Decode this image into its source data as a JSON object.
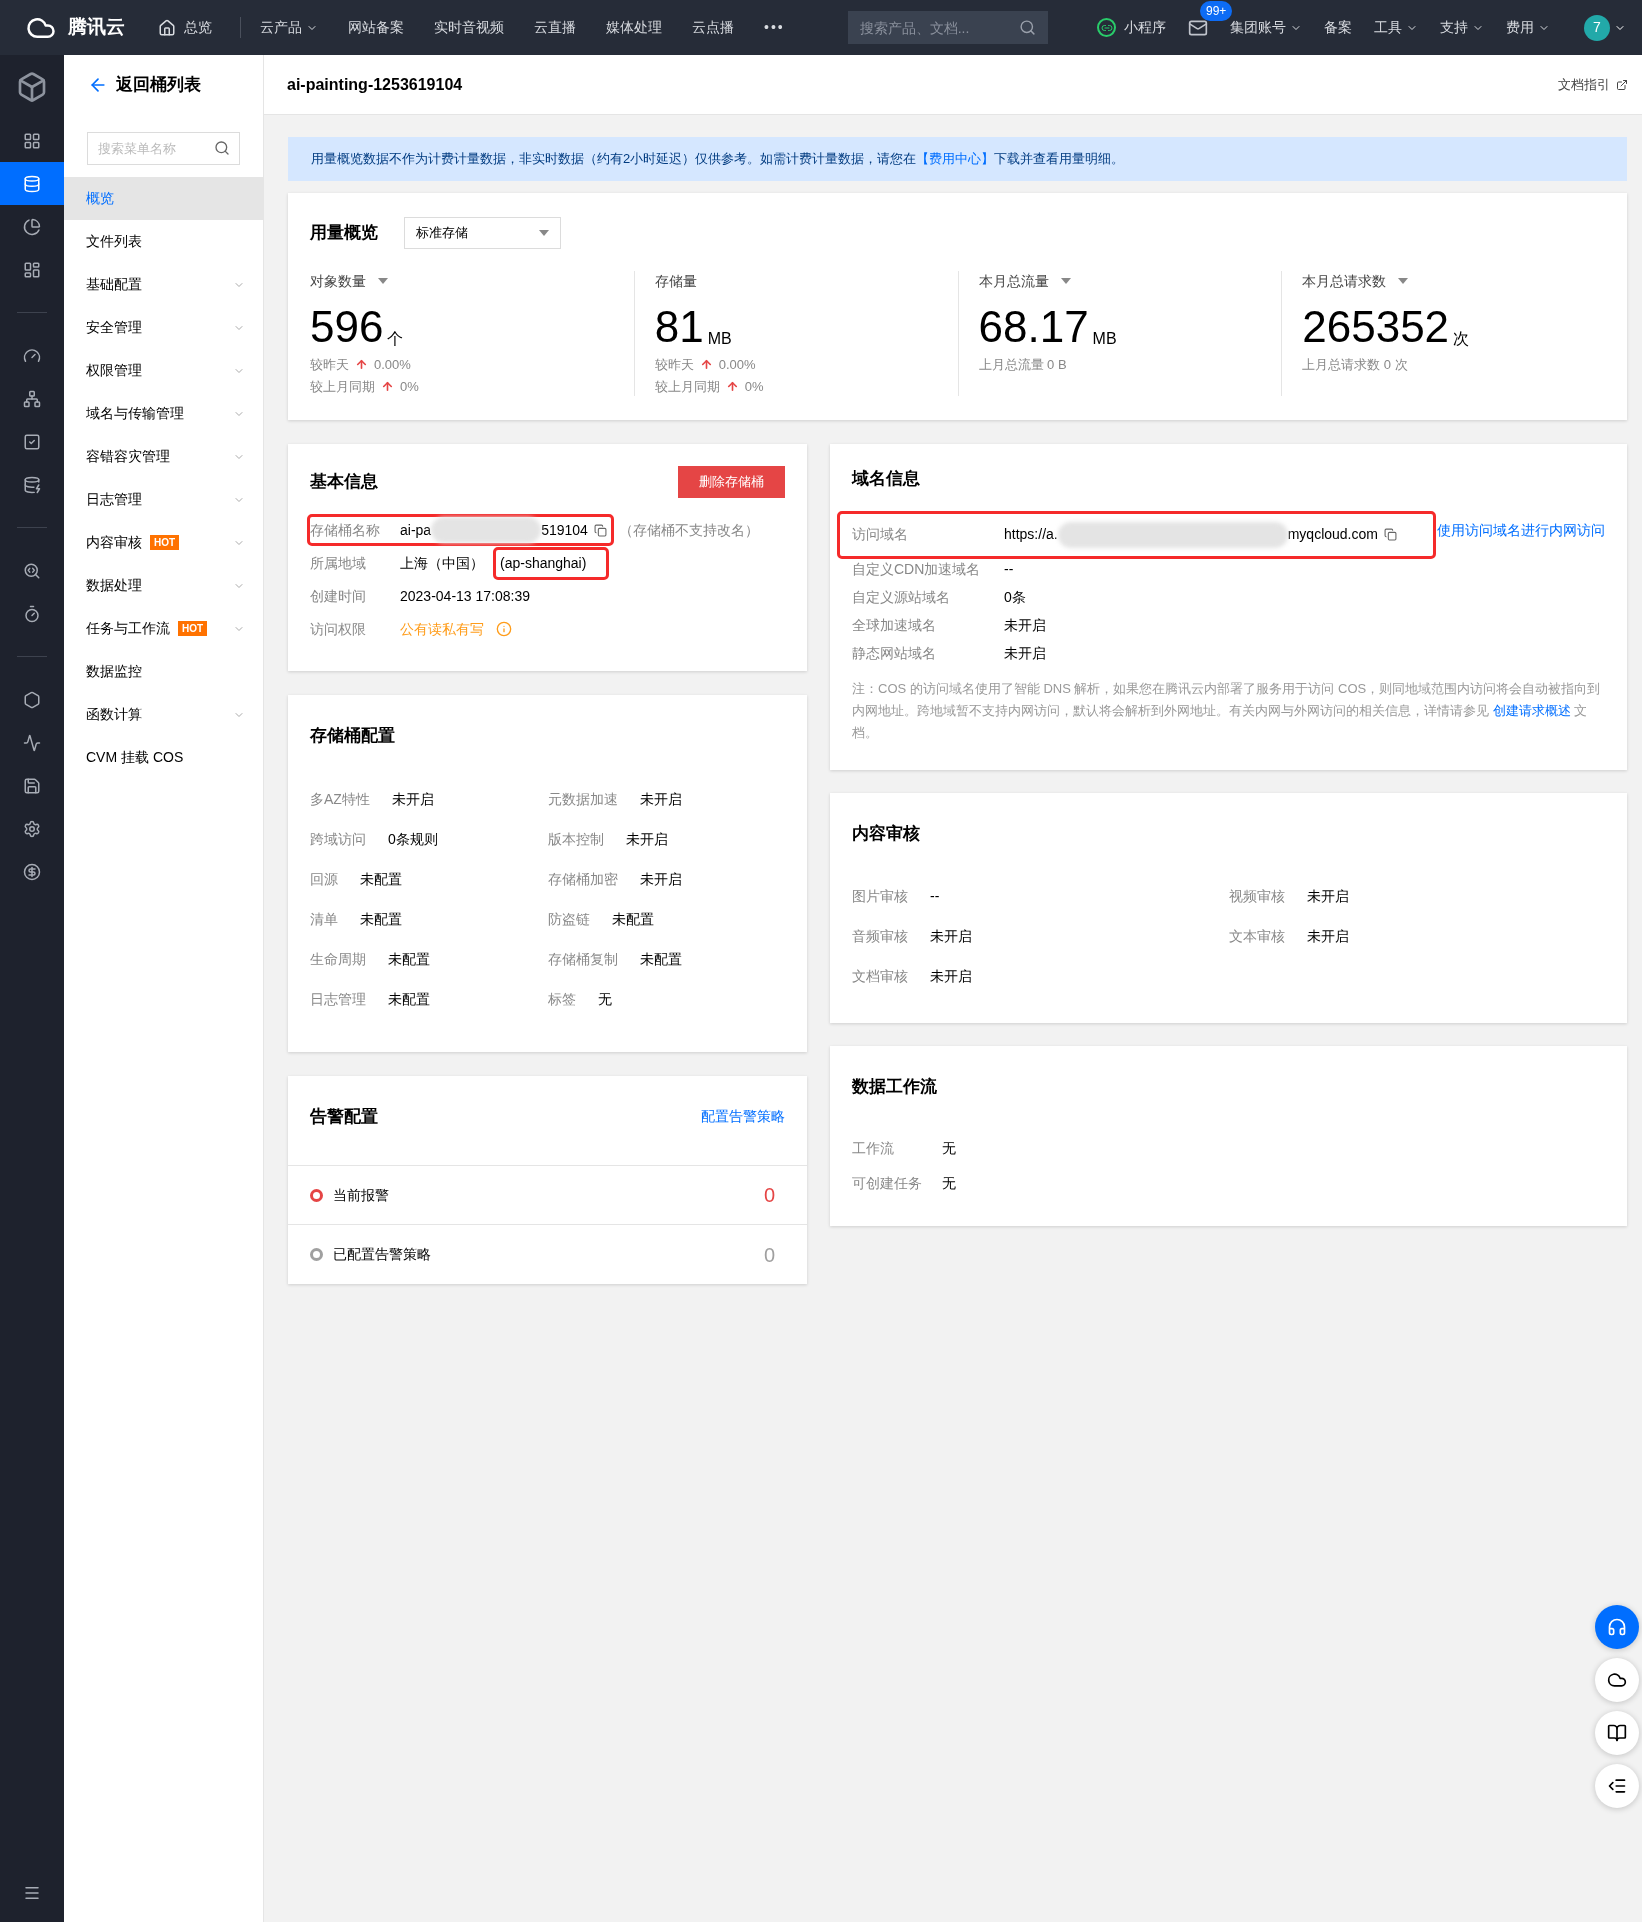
{
  "topbar": {
    "brand": "腾讯云",
    "nav": [
      {
        "label": "总览",
        "kind": "home"
      },
      {
        "label": "云产品",
        "kind": "dropdown"
      },
      {
        "label": "网站备案",
        "kind": "plain"
      },
      {
        "label": "实时音视频",
        "kind": "plain"
      },
      {
        "label": "云直播",
        "kind": "plain"
      },
      {
        "label": "媒体处理",
        "kind": "plain"
      },
      {
        "label": "云点播",
        "kind": "plain"
      },
      {
        "label": "•••",
        "kind": "plain"
      }
    ],
    "search": {
      "placeholder": "搜索产品、文档..."
    },
    "right": [
      {
        "label": "小程序",
        "kind": "miniprogram"
      },
      {
        "label": "99+",
        "kind": "mail"
      },
      {
        "label": "集团账号",
        "kind": "dropdown"
      },
      {
        "label": "备案",
        "kind": "plain"
      },
      {
        "label": "工具",
        "kind": "dropdown"
      },
      {
        "label": "支持",
        "kind": "dropdown"
      },
      {
        "label": "费用",
        "kind": "dropdown"
      }
    ],
    "avatar": "7"
  },
  "icon_rail": [
    {
      "selected": false
    },
    {
      "selected": true
    },
    {
      "selected": false
    },
    {
      "selected": false
    },
    {
      "selected": false
    },
    {
      "selected": false
    },
    {
      "selected": false
    },
    {
      "selected": false
    },
    {
      "selected": false
    },
    {
      "selected": false
    },
    {
      "selected": false
    },
    {
      "selected": false
    },
    {
      "selected": false
    },
    {
      "selected": false
    },
    {
      "selected": false
    }
  ],
  "sidebar": {
    "back": "返回桶列表",
    "search": {
      "placeholder": "搜索菜单名称"
    },
    "items": [
      {
        "label": "概览",
        "selected": true,
        "expandable": false
      },
      {
        "label": "文件列表",
        "selected": false,
        "expandable": false
      },
      {
        "label": "基础配置",
        "selected": false,
        "expandable": true
      },
      {
        "label": "安全管理",
        "selected": false,
        "expandable": true
      },
      {
        "label": "权限管理",
        "selected": false,
        "expandable": true
      },
      {
        "label": "域名与传输管理",
        "selected": false,
        "expandable": true
      },
      {
        "label": "容错容灾管理",
        "selected": false,
        "expandable": true
      },
      {
        "label": "日志管理",
        "selected": false,
        "expandable": true
      },
      {
        "label": "内容审核",
        "selected": false,
        "expandable": true,
        "badge": "HOT"
      },
      {
        "label": "数据处理",
        "selected": false,
        "expandable": true
      },
      {
        "label": "任务与工作流",
        "selected": false,
        "expandable": true,
        "badge": "HOT"
      },
      {
        "label": "数据监控",
        "selected": false,
        "expandable": false
      },
      {
        "label": "函数计算",
        "selected": false,
        "expandable": true
      },
      {
        "label": "CVM 挂载 COS",
        "selected": false,
        "expandable": false
      }
    ]
  },
  "page": {
    "title": "ai-painting-1253619104",
    "doc_link": "文档指引"
  },
  "notice": {
    "before": "用量概览数据不作为计费计量数据，非实时数据（约有2小时延迟）仅供参考。如需计费计量数据，请您在",
    "link": "【费用中心】",
    "after": "下载并查看用量明细。"
  },
  "usage": {
    "title": "用量概览",
    "select": "标准存储",
    "stats": [
      {
        "label": "对象数量",
        "dropdown": true,
        "value": "596",
        "unit": "个",
        "lines": [
          {
            "kind": "trend",
            "label": "较昨天",
            "value": "0.00%"
          },
          {
            "kind": "trend",
            "label": "较上月同期",
            "value": "0%"
          }
        ]
      },
      {
        "label": "存储量",
        "dropdown": false,
        "value": "81",
        "unit": "MB",
        "lines": [
          {
            "kind": "trend",
            "label": "较昨天",
            "value": "0.00%"
          },
          {
            "kind": "trend",
            "label": "较上月同期",
            "value": "0%"
          }
        ]
      },
      {
        "label": "本月总流量",
        "dropdown": true,
        "value": "68.17",
        "unit": "MB",
        "lines": [
          {
            "kind": "text",
            "label": "上月总流量 0 B"
          }
        ]
      },
      {
        "label": "本月总请求数",
        "dropdown": true,
        "value": "265352",
        "unit": "次",
        "lines": [
          {
            "kind": "text",
            "label": "上月总请求数 0 次"
          }
        ]
      }
    ]
  },
  "basic_info": {
    "title": "基本信息",
    "delete_button": "删除存储桶",
    "rows": [
      {
        "label": "存储桶名称",
        "kind": "bucket",
        "value_start": "ai-pa",
        "value_end": "519104",
        "note": "（存储桶不支持改名）",
        "highlighted": true
      },
      {
        "label": "所属地域",
        "kind": "region",
        "value": "上海（中国）",
        "code": "(ap-shanghai)",
        "highlighted": true
      },
      {
        "label": "创建时间",
        "kind": "plain",
        "value": "2023-04-13 17:08:39"
      },
      {
        "label": "访问权限",
        "kind": "permission",
        "value": "公有读私有写"
      }
    ]
  },
  "bucket_config": {
    "title": "存储桶配置",
    "items": [
      {
        "label": "多AZ特性",
        "value": "未开启"
      },
      {
        "label": "元数据加速",
        "value": "未开启"
      },
      {
        "label": "跨域访问",
        "value": "0条规则"
      },
      {
        "label": "版本控制",
        "value": "未开启"
      },
      {
        "label": "回源",
        "value": "未配置"
      },
      {
        "label": "存储桶加密",
        "value": "未开启"
      },
      {
        "label": "清单",
        "value": "未配置"
      },
      {
        "label": "防盗链",
        "value": "未配置"
      },
      {
        "label": "生命周期",
        "value": "未配置"
      },
      {
        "label": "存储桶复制",
        "value": "未配置"
      },
      {
        "label": "日志管理",
        "value": "未配置"
      },
      {
        "label": "标签",
        "value": "无"
      }
    ]
  },
  "alarm": {
    "title": "告警配置",
    "link": "配置告警策略",
    "rows": [
      {
        "label": "当前报警",
        "count": "0",
        "color": "#e54545"
      },
      {
        "label": "已配置告警策略",
        "count": "0",
        "color": "#a0a0a0"
      }
    ]
  },
  "domain": {
    "title": "域名信息",
    "rows": [
      {
        "label": "访问域名",
        "kind": "domain",
        "value_start": "https://a.",
        "value_end": "myqcloud.com",
        "highlighted": true
      },
      {
        "label": "自定义CDN加速域名",
        "kind": "plain",
        "value": "--"
      },
      {
        "label": "自定义源站域名",
        "kind": "plain",
        "value": "0条"
      },
      {
        "label": "全球加速域名",
        "kind": "plain",
        "value": "未开启"
      },
      {
        "label": "静态网站域名",
        "kind": "plain",
        "value": "未开启"
      }
    ],
    "side_link": "使用访问域名进行内网访问",
    "note": {
      "before": "注：COS 的访问域名使用了智能 DNS 解析，如果您在腾讯云内部署了服务用于访问 COS，则同地域范围内访问将会自动被指向到内网地址。跨地域暂不支持内网访问，默认将会解析到外网地址。有关内网与外网访问的相关信息，详情请参见 ",
      "link": "创建请求概述",
      "after": " 文档。"
    }
  },
  "content_review": {
    "title": "内容审核",
    "items": [
      {
        "label": "图片审核",
        "value": "--"
      },
      {
        "label": "视频审核",
        "value": "未开启"
      },
      {
        "label": "音频审核",
        "value": "未开启"
      },
      {
        "label": "文本审核",
        "value": "未开启"
      },
      {
        "label": "文档审核",
        "value": "未开启"
      }
    ]
  },
  "workflow": {
    "title": "数据工作流",
    "items": [
      {
        "label": "工作流",
        "value": "无"
      },
      {
        "label": "可创建任务",
        "value": "无"
      }
    ]
  }
}
